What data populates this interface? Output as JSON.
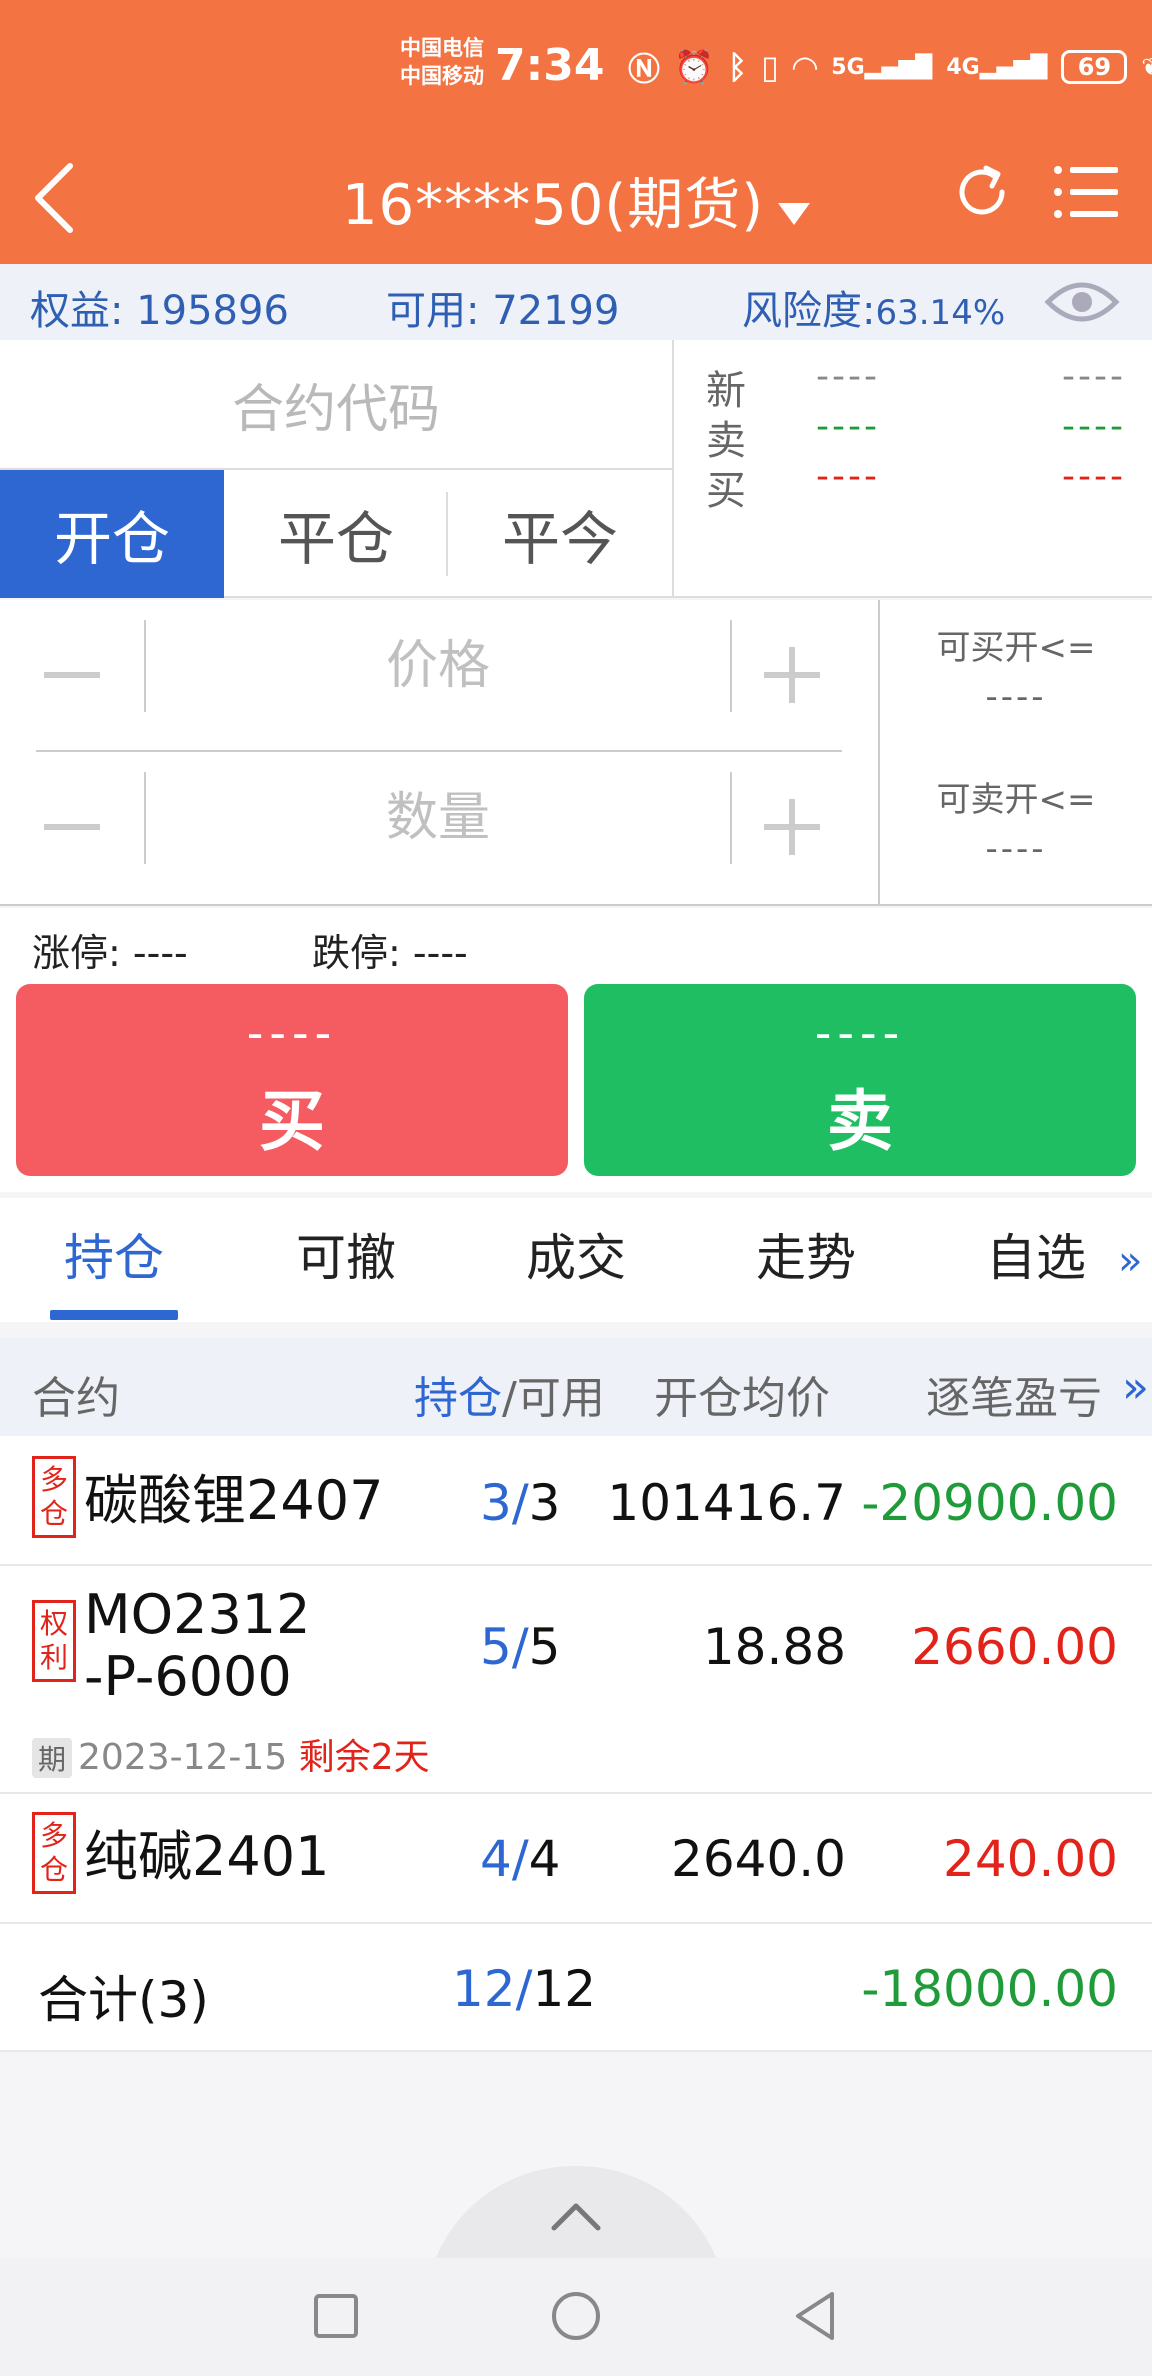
{
  "status_bar": {
    "carrier_1": "中国电信",
    "carrier_2": "中国移动",
    "time": "7:34",
    "net_1": "5G",
    "net_2": "4G",
    "battery": "69"
  },
  "header": {
    "title": "16****50(期货)",
    "accent_color": "#f37442"
  },
  "account": {
    "equity_label": "权益: ",
    "equity_value": "195896",
    "available_label": "可用: ",
    "available_value": "72199",
    "risk_label": "风险度:",
    "risk_value": "63.14%"
  },
  "order": {
    "contract_placeholder": "合约代码",
    "tabs": [
      {
        "label": "开仓",
        "active": true
      },
      {
        "label": "平仓",
        "active": false
      },
      {
        "label": "平今",
        "active": false
      }
    ],
    "quotes": [
      {
        "label": "新",
        "v1": "----",
        "v2": "----",
        "color": "grey"
      },
      {
        "label": "卖",
        "v1": "----",
        "v2": "----",
        "color": "green"
      },
      {
        "label": "买",
        "v1": "----",
        "v2": "----",
        "color": "red"
      }
    ],
    "price_placeholder": "价格",
    "qty_placeholder": "数量",
    "can_buy_label": "可买开<=",
    "can_buy_value": "----",
    "can_sell_label": "可卖开<=",
    "can_sell_value": "----",
    "limit_up_label": "涨停: ",
    "limit_up_value": "----",
    "limit_down_label": "跌停: ",
    "limit_down_value": "----",
    "buy_price": "----",
    "buy_label": "买",
    "sell_price": "----",
    "sell_label": "卖"
  },
  "subtabs": [
    {
      "label": "持仓",
      "active": true
    },
    {
      "label": "可撤",
      "active": false
    },
    {
      "label": "成交",
      "active": false
    },
    {
      "label": "走势",
      "active": false
    },
    {
      "label": "自选",
      "active": false
    }
  ],
  "more_tabs_glyph": "»",
  "positions": {
    "columns": {
      "contract": "合约",
      "hold": "持仓",
      "slash_avail": "/可用",
      "avg_price": "开仓均价",
      "pnl": "逐笔盈亏",
      "more": "»"
    },
    "rows": [
      {
        "tag": "多仓",
        "name": "碳酸锂2407",
        "hold": "3",
        "avail": "3",
        "avg_price": "101416.7",
        "pnl": "-20900.00",
        "pnl_color": "green"
      },
      {
        "tag": "权利",
        "name": "MO2312",
        "name2": "-P-6000",
        "hold": "5",
        "avail": "5",
        "avg_price": "18.88",
        "pnl": "2660.00",
        "pnl_color": "red",
        "expiry_tag": "期",
        "expiry_date": "2023-12-15",
        "remaining": "剩余2天"
      },
      {
        "tag": "多仓",
        "name": "纯碱2401",
        "hold": "4",
        "avail": "4",
        "avg_price": "2640.0",
        "pnl": "240.00",
        "pnl_color": "red"
      }
    ],
    "total": {
      "label": "合计(3)",
      "hold": "12",
      "avail": "12",
      "pnl": "-18000.00"
    }
  }
}
